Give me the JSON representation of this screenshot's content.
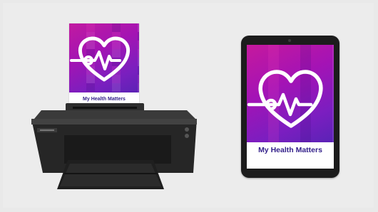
{
  "printed_page": {
    "title": "My Health Matters",
    "icon": "heart-pulse-icon",
    "colors": {
      "gradient_start": "#c21aa0",
      "gradient_end": "#5b23b5",
      "title": "#33208a"
    }
  },
  "tablet_page": {
    "title": "My Health Matters",
    "subtitle": "",
    "icon": "heart-pulse-icon",
    "colors": {
      "gradient_start": "#c6199d",
      "gradient_end": "#5a23b6",
      "title": "#33208a"
    }
  },
  "colors": {
    "background": "#ececec",
    "printer_body": "#232323",
    "tablet_bezel": "#1c1c1c"
  }
}
